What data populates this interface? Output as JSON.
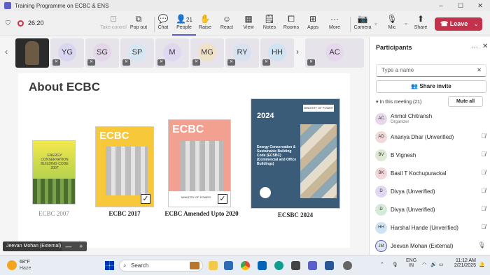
{
  "window": {
    "title": "Training Programme on ECBC & ENS"
  },
  "meeting": {
    "timer": "26:20"
  },
  "toolbar": {
    "take_control": "Take control",
    "pop_out": "Pop out",
    "chat": "Chat",
    "people": "People",
    "people_count": "21",
    "raise": "Raise",
    "react": "React",
    "view": "View",
    "notes": "Notes",
    "rooms": "Rooms",
    "apps": "Apps",
    "more": "More",
    "camera": "Camera",
    "mic": "Mic",
    "share": "Share",
    "leave": "Leave"
  },
  "participant_strip": [
    {
      "initials": "YG",
      "color": "#d9d6f0"
    },
    {
      "initials": "SG",
      "color": "#e4d7ea"
    },
    {
      "initials": "SP",
      "color": "#d6e6f3"
    },
    {
      "initials": "M",
      "color": "#e0d8f0"
    },
    {
      "initials": "MG",
      "color": "#efe2c9"
    },
    {
      "initials": "RY",
      "color": "#d8e2f1"
    },
    {
      "initials": "HH",
      "color": "#cfe3f2"
    },
    {
      "initials": "AC",
      "color": "#e6d7ec"
    }
  ],
  "slide": {
    "title": "About ECBC",
    "book1": {
      "caption": "ECBC 2007",
      "text": "ENERGY CONSERVATION BUILDING CODE 2007"
    },
    "book2": {
      "caption": "ECBC 2017",
      "heading": "ECBC"
    },
    "book3": {
      "caption": "ECBC Amended Upto 2020",
      "heading": "ECBC",
      "ministry": "MINISTRY OF POWER"
    },
    "book4": {
      "caption": "ECSBC 2024",
      "year": "2024",
      "ministry": "MINISTRY OF POWER",
      "text": "Energy Conservation & Sustainable Building Code (ECSBC) (Commercial and Office Buildings)"
    }
  },
  "presenter": {
    "name": "Jeevan Mohan (External)"
  },
  "zoom": {
    "minus": "—",
    "plus": "+"
  },
  "panel": {
    "title": "Participants",
    "search_placeholder": "Type a name",
    "share_invite": "Share invite",
    "in_meeting": "In this meeting (21)",
    "mute_all": "Mute all",
    "people": [
      {
        "initials": "AC",
        "name": "Anmol Chitransh",
        "role": "Organizer",
        "color": "#e6d7ec"
      },
      {
        "initials": "AD",
        "name": "Ananya Dhar (Unverified)",
        "role": "",
        "color": "#f2d9d9"
      },
      {
        "initials": "BV",
        "name": "B Vignesh",
        "role": "",
        "color": "#dfe8d2"
      },
      {
        "initials": "BK",
        "name": "Basil T Kochupurackal",
        "role": "",
        "color": "#f1d6dc"
      },
      {
        "initials": "D",
        "name": "Divya (Unverified)",
        "role": "",
        "color": "#e0d8f0"
      },
      {
        "initials": "D",
        "name": "Divya (Unverified)",
        "role": "",
        "color": "#d6ead8"
      },
      {
        "initials": "HH",
        "name": "Harshal Hande (Unverified)",
        "role": "",
        "color": "#cfe3f2"
      },
      {
        "initials": "JM",
        "name": "Jeevan Mohan (External)",
        "role": "",
        "color": "#dfe6ef"
      }
    ]
  },
  "taskbar": {
    "temperature": "68°F",
    "condition": "Haze",
    "search": "Search",
    "lang1": "ENG",
    "lang2": "IN",
    "time": "11:12 AM",
    "date": "2/21/2025"
  }
}
